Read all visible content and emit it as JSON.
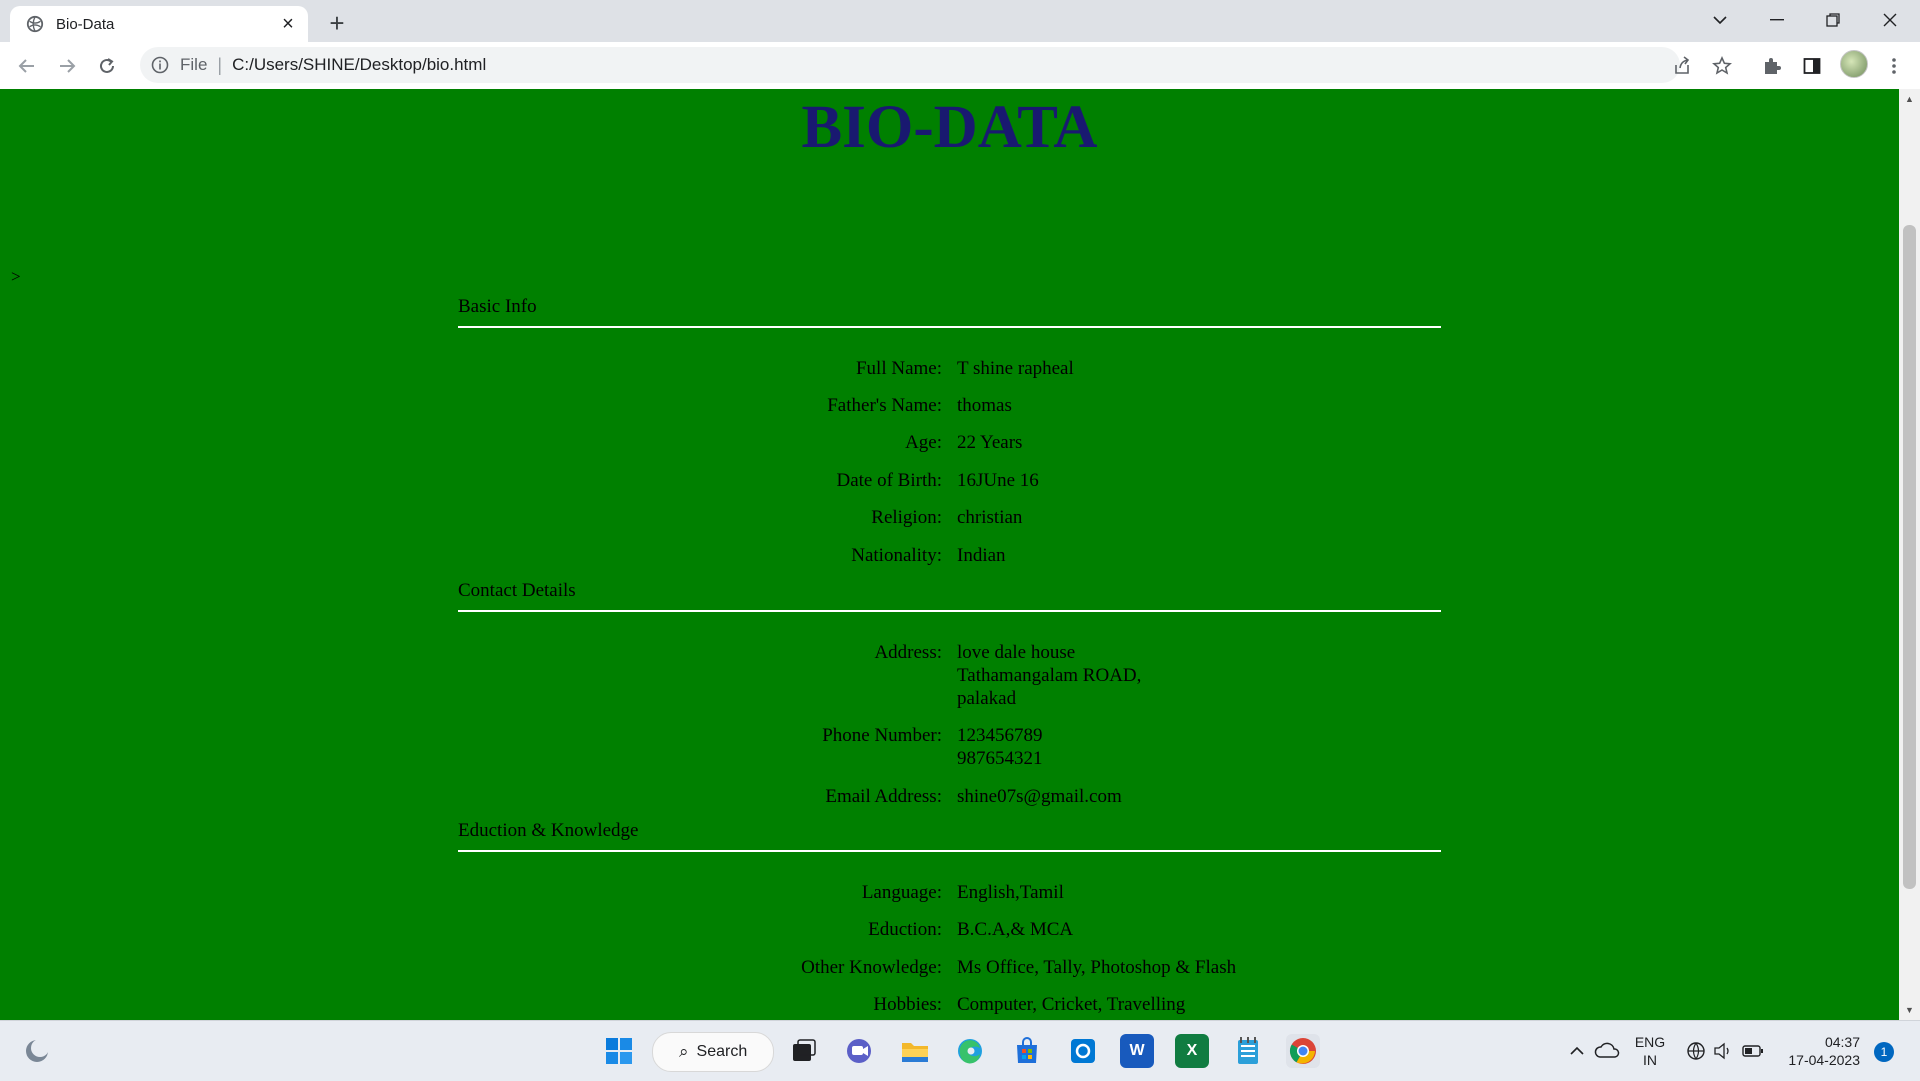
{
  "browser": {
    "tab_title": "Bio-Data",
    "new_tab_glyph": "+",
    "close_glyph": "×",
    "scheme": "File",
    "separator": "|",
    "url": "C:/Users/SHINE/Desktop/bio.html"
  },
  "page": {
    "title": "BIO-DATA",
    "stray_char": ">",
    "sections": {
      "basic": {
        "heading": "Basic Info",
        "rows": [
          {
            "label": "Full Name:",
            "value": "T shine rapheal"
          },
          {
            "label": "Father's Name:",
            "value": "thomas"
          },
          {
            "label": "Age:",
            "value": "22 Years"
          },
          {
            "label": "Date of Birth:",
            "value": "16JUne 16"
          },
          {
            "label": "Religion:",
            "value": "christian"
          },
          {
            "label": "Nationality:",
            "value": "Indian"
          }
        ]
      },
      "contact": {
        "heading": "Contact Details",
        "address_label": "Address:",
        "address_lines": [
          "love dale house",
          "Tathamangalam ROAD,",
          "palakad"
        ],
        "phone_label": "Phone Number:",
        "phone_lines": [
          "123456789",
          "987654321"
        ],
        "email_label": "Email Address:",
        "email": "shine07s@gmail.com"
      },
      "education": {
        "heading": "Eduction & Knowledge",
        "rows": [
          {
            "label": "Language:",
            "value": "English,Tamil"
          },
          {
            "label": "Eduction:",
            "value": "B.C.A,& MCA"
          },
          {
            "label": "Other Knowledge:",
            "value": "Ms Office, Tally, Photoshop & Flash"
          },
          {
            "label": "Hobbies:",
            "value": "Computer, Cricket, Travelling"
          }
        ]
      }
    }
  },
  "taskbar": {
    "search_label": "Search",
    "search_glyph": "⌕",
    "lang_top": "ENG",
    "lang_bottom": "IN",
    "time": "04:37",
    "date": "17-04-2023",
    "notification_count": "1",
    "word_letter": "W",
    "excel_letter": "X"
  },
  "colors": {
    "page_background": "#008000",
    "title_color": "#191970",
    "rule_color": "#ffffff"
  }
}
